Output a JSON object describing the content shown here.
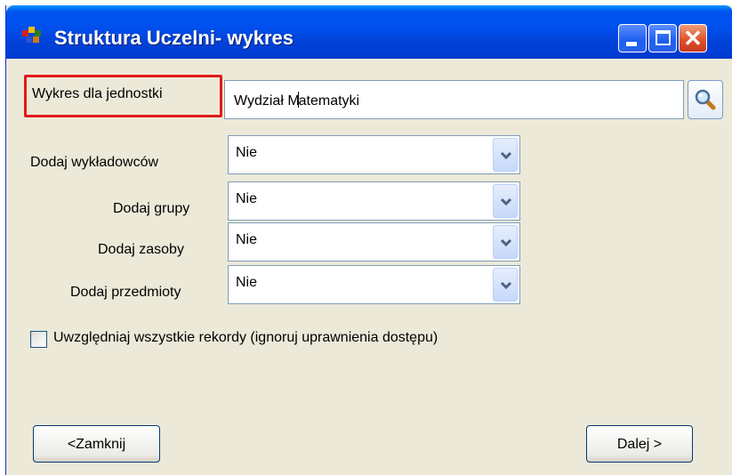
{
  "window": {
    "title": "Struktura Uczelni- wykres"
  },
  "titlebar_buttons": {
    "minimize_icon": "minimize-icon",
    "maximize_icon": "maximize-icon",
    "close_icon": "close-icon",
    "close_glyph": "✕"
  },
  "unit": {
    "label": "Wykres dla jednostki",
    "value_before_caret": "Wydział M",
    "value_after_caret": "atematyki",
    "search_icon": "magnifier-icon"
  },
  "options": [
    {
      "label": "Dodaj wykładowców",
      "value": "Nie"
    },
    {
      "label": "Dodaj grupy",
      "value": "Nie"
    },
    {
      "label": "Dodaj zasoby",
      "value": "Nie"
    },
    {
      "label": "Dodaj przedmioty",
      "value": "Nie"
    }
  ],
  "include_all": {
    "label": "Uwzględniaj wszystkie rekordy (ignoruj uprawnienia dostępu)",
    "checked": false
  },
  "buttons": {
    "close": "<Zamknij",
    "next": "Dalej >"
  },
  "colors": {
    "titlebar": "#0053ee",
    "highlight_border": "#e21a1a",
    "window_bg": "#ece9d8",
    "close_button": "#e0542c"
  }
}
